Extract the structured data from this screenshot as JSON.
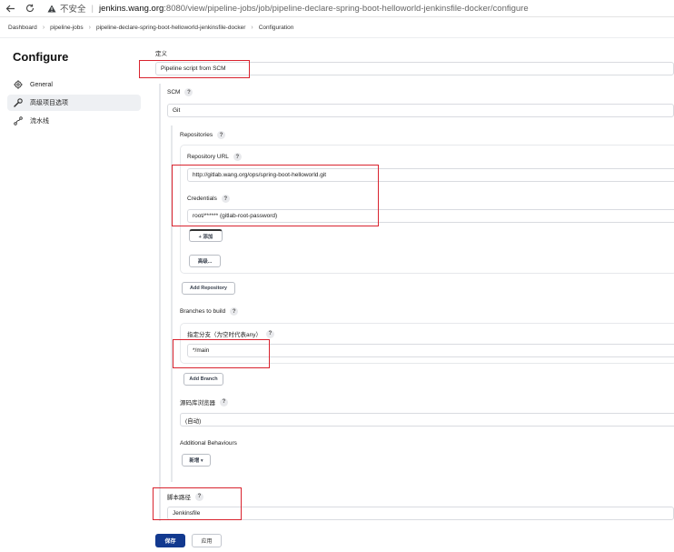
{
  "browser": {
    "insecure_label": "不安全",
    "url_host": "jenkins.wang.org",
    "url_path": ":8080/view/pipeline-jobs/job/pipeline-declare-spring-boot-helloworld-jenkinsfile-docker/configure"
  },
  "breadcrumb": [
    "Dashboard",
    "pipeline-jobs",
    "pipeline-declare-spring-boot-helloworld-jenkinsfile-docker",
    "Configuration"
  ],
  "sidebar": {
    "title": "Configure",
    "items": [
      {
        "label": "General",
        "icon": "gear-icon"
      },
      {
        "label": "高级项目选项",
        "icon": "wrench-icon"
      },
      {
        "label": "流水线",
        "icon": "pipeline-icon"
      }
    ]
  },
  "form": {
    "definition_label": "定义",
    "definition_value": "Pipeline script from SCM",
    "scm_label": "SCM",
    "scm_value": "Git",
    "repositories_label": "Repositories",
    "repo_url_label": "Repository URL",
    "repo_url_value": "http://gitlab.wang.org/ops/spring-boot-helloworld.git",
    "credentials_label": "Credentials",
    "credentials_value": "root/****** (gitlab-root-password)",
    "add_credential_label": "+ 添加",
    "advanced_label": "高级...",
    "add_repository_label": "Add Repository",
    "branches_label": "Branches to build",
    "branch_specifier_label": "指定分支（为空时代表any）",
    "branch_value": "*/main",
    "add_branch_label": "Add Branch",
    "repo_browser_label": "源码库浏览器",
    "repo_browser_value": "(自动)",
    "additional_behaviours_label": "Additional Behaviours",
    "add_behaviour_label": "新增 ▾",
    "script_path_label": "脚本路径",
    "script_path_value": "Jenkinsfile",
    "help_glyph": "?"
  },
  "footer": {
    "save_label": "保存",
    "apply_label": "应用"
  },
  "colors": {
    "primary": "#12398f",
    "highlight": "#d9232e"
  }
}
